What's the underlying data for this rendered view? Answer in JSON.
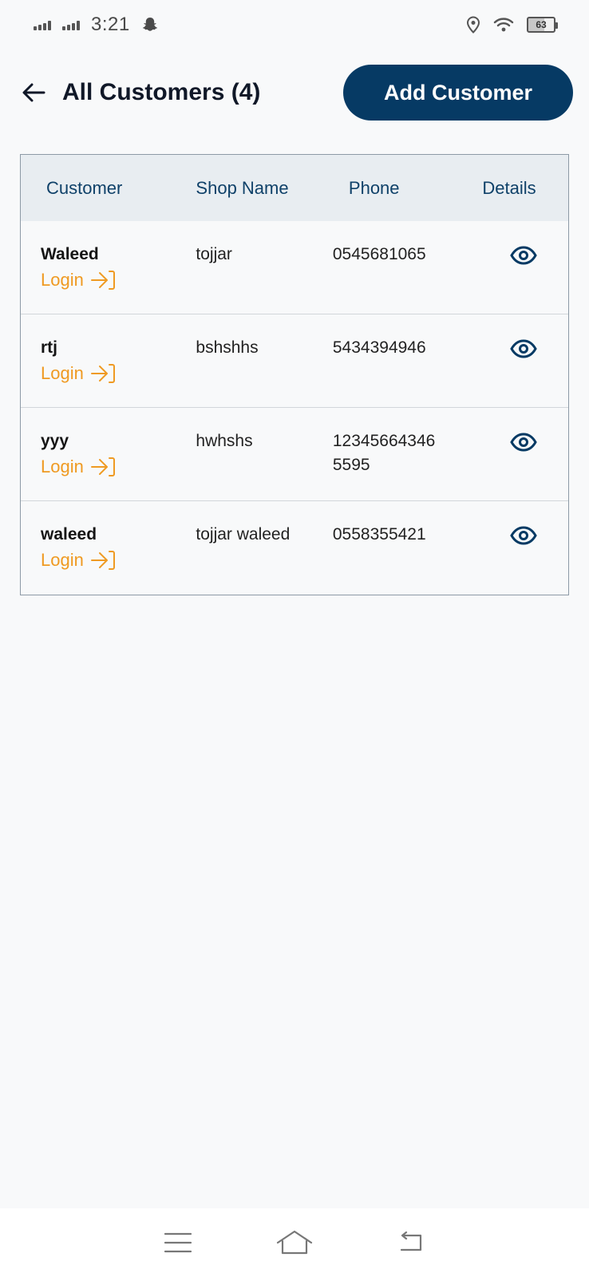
{
  "status_bar": {
    "time": "3:21",
    "battery": "63"
  },
  "header": {
    "title": "All Customers (4)",
    "add_button": "Add Customer"
  },
  "table": {
    "columns": [
      "Customer",
      "Shop Name",
      "Phone",
      "Details"
    ],
    "login_label": "Login",
    "rows": [
      {
        "customer": "Waleed",
        "shop": "tojjar",
        "phone": "0545681065"
      },
      {
        "customer": "rtj",
        "shop": "bshshhs",
        "phone": "5434394946"
      },
      {
        "customer": "yyy",
        "shop": "hwhshs",
        "phone": "12345664346\n5595"
      },
      {
        "customer": "waleed",
        "shop": "tojjar waleed",
        "phone": "0558355421"
      }
    ]
  },
  "colors": {
    "primary": "#063a64",
    "accent": "#ef9a22",
    "header_bg": "#e8edf1",
    "page_bg": "#f8f9fa"
  },
  "icons": {
    "back": "arrow-left-icon",
    "details": "eye-icon",
    "login": "login-arrow-icon",
    "nav_menu": "menu-icon",
    "nav_home": "home-icon",
    "nav_back": "back-icon"
  }
}
